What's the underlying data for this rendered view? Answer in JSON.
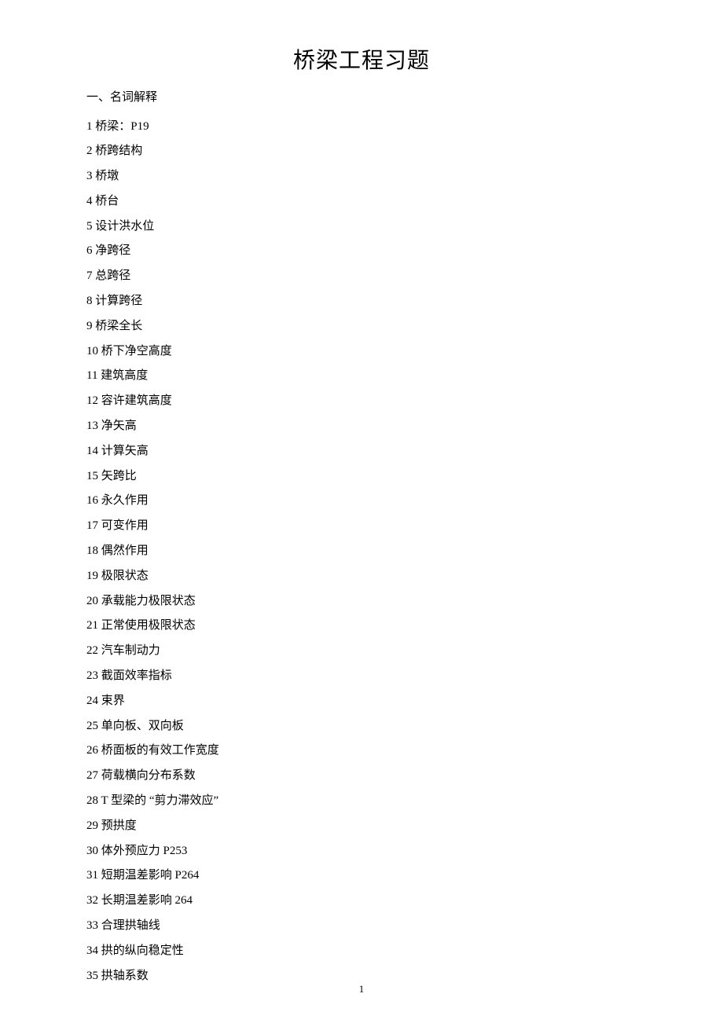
{
  "title": "桥梁工程习题",
  "section_heading": "一、名词解释",
  "items": [
    {
      "num": "1",
      "text": "桥梁：P19"
    },
    {
      "num": "2",
      "text": "桥跨结构"
    },
    {
      "num": "3",
      "text": "桥墩"
    },
    {
      "num": "4",
      "text": "桥台"
    },
    {
      "num": "5",
      "text": "设计洪水位"
    },
    {
      "num": "6",
      "text": "净跨径"
    },
    {
      "num": "7",
      "text": "总跨径"
    },
    {
      "num": "8",
      "text": "计算跨径"
    },
    {
      "num": "9",
      "text": "桥梁全长"
    },
    {
      "num": "10",
      "text": "桥下净空高度"
    },
    {
      "num": "11",
      "text": "建筑高度"
    },
    {
      "num": "12",
      "text": "容许建筑高度"
    },
    {
      "num": "13",
      "text": "净矢高"
    },
    {
      "num": "14",
      "text": "计算矢高"
    },
    {
      "num": "15",
      "text": "矢跨比"
    },
    {
      "num": "16",
      "text": "永久作用"
    },
    {
      "num": "17",
      "text": "可变作用"
    },
    {
      "num": "18",
      "text": "偶然作用"
    },
    {
      "num": "19",
      "text": "极限状态"
    },
    {
      "num": "20",
      "text": "承载能力极限状态"
    },
    {
      "num": "21",
      "text": "正常使用极限状态"
    },
    {
      "num": "22",
      "text": "汽车制动力"
    },
    {
      "num": "23",
      "text": "截面效率指标"
    },
    {
      "num": "24",
      "text": "束界"
    },
    {
      "num": "25",
      "text": "单向板、双向板"
    },
    {
      "num": "26",
      "text": "桥面板的有效工作宽度"
    },
    {
      "num": "27",
      "text": "荷载横向分布系数"
    },
    {
      "num": "28",
      "text": "T 型梁的 “剪力滞效应”"
    },
    {
      "num": "29",
      "text": "预拱度"
    },
    {
      "num": "30",
      "text": "体外预应力 P253"
    },
    {
      "num": "31",
      "text": "短期温差影响 P264"
    },
    {
      "num": "32",
      "text": "长期温差影响 264"
    },
    {
      "num": "33",
      "text": "合理拱轴线"
    },
    {
      "num": "34",
      "text": "拱的纵向稳定性"
    },
    {
      "num": "35",
      "text": "拱轴系数"
    }
  ],
  "page_number": "1"
}
